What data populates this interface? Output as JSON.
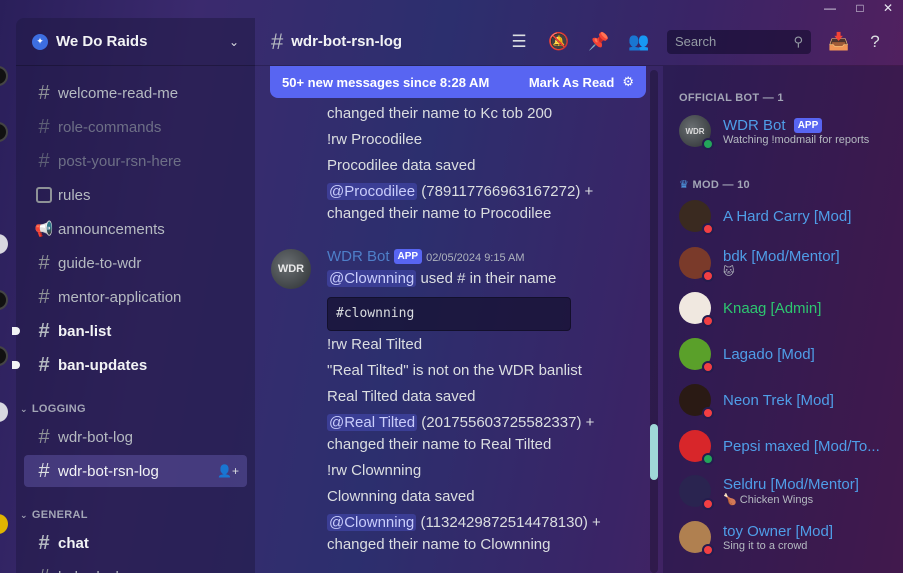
{
  "server": {
    "name": "We Do Raids"
  },
  "channels": [
    {
      "name": "welcome-read-me",
      "state": "normal"
    },
    {
      "name": "role-commands",
      "state": "muted"
    },
    {
      "name": "post-your-rsn-here",
      "state": "muted"
    },
    {
      "name": "rules",
      "state": "normal"
    },
    {
      "name": "announcements",
      "state": "normal"
    },
    {
      "name": "guide-to-wdr",
      "state": "normal"
    },
    {
      "name": "mentor-application",
      "state": "normal"
    },
    {
      "name": "ban-list",
      "state": "unread"
    },
    {
      "name": "ban-updates",
      "state": "unread"
    }
  ],
  "categories": {
    "logging": "LOGGING",
    "general": "GENERAL"
  },
  "logging_channels": [
    {
      "name": "wdr-bot-log"
    },
    {
      "name": "wdr-bot-rsn-log"
    }
  ],
  "general_channels": [
    {
      "name": "chat"
    },
    {
      "name": "help-desk"
    }
  ],
  "header": {
    "channel": "wdr-bot-rsn-log",
    "search_placeholder": "Search"
  },
  "newbar": {
    "text": "50+ new messages since 8:28 AM",
    "action": "Mark As Read"
  },
  "messages": {
    "top_lines": [
      "changed their name to Kc tob 200",
      "!rw Procodilee",
      "Procodilee data saved"
    ],
    "procodilee_mention": "@Procodilee",
    "procodilee_id": "(789117766963167272) +",
    "procodilee_changed": "changed their name to Procodilee",
    "author": "WDR Bot",
    "app_badge": "APP",
    "timestamp": "02/05/2024 9:15 AM",
    "avatar_text": "WDR",
    "clownning_mention": "@Clownning",
    "clownning_used": "used # in their name",
    "code": "#clownning",
    "lines_a": [
      "!rw Real Tilted",
      "\"Real Tilted\" is not on the WDR banlist",
      "Real Tilted data saved"
    ],
    "realtilted_mention": "@Real Tilted",
    "realtilted_id": "(201755603725582337) +",
    "realtilted_changed": "changed their name to Real Tilted",
    "lines_b": [
      "!rw Clownning",
      "Clownning data saved"
    ],
    "clownning_id": "(1132429872514478130) +",
    "clownning_changed": "changed their name to Clownning"
  },
  "members": {
    "official_bot_header": "OFFICIAL BOT — 1",
    "bot": {
      "name": "WDR Bot",
      "badge": "APP",
      "sub": "Watching !modmail for reports"
    },
    "mod_header": "MOD — 10",
    "mods": [
      {
        "name": "A Hard Carry [Mod]",
        "sub": "",
        "status": "dnd",
        "color": "#3a2a20"
      },
      {
        "name": "bdk [Mod/Mentor]",
        "sub": "🐱",
        "status": "dnd",
        "color": "#7a3a2a"
      },
      {
        "name": "Knaag [Admin]",
        "sub": "",
        "status": "dnd",
        "color": "#f0e8e0",
        "green": true
      },
      {
        "name": "Lagado [Mod]",
        "sub": "",
        "status": "dnd",
        "color": "#5aa02a"
      },
      {
        "name": "Neon Trek [Mod]",
        "sub": "",
        "status": "dnd",
        "color": "#2a1a14"
      },
      {
        "name": "Pepsi maxed [Mod/To...",
        "sub": "",
        "status": "online",
        "color": "#d8262a"
      },
      {
        "name": "Seldru [Mod/Mentor]",
        "sub": "🍗 Chicken Wings",
        "status": "dnd",
        "color": "#2a2450"
      },
      {
        "name": "toy Owner [Mod]",
        "sub": "Sing it to a crowd",
        "status": "dnd",
        "color": "#b08050"
      }
    ]
  },
  "colors": {
    "accent": "#5865f2",
    "mod_name": "#4f9ee8",
    "admin_name": "#2dc770"
  }
}
